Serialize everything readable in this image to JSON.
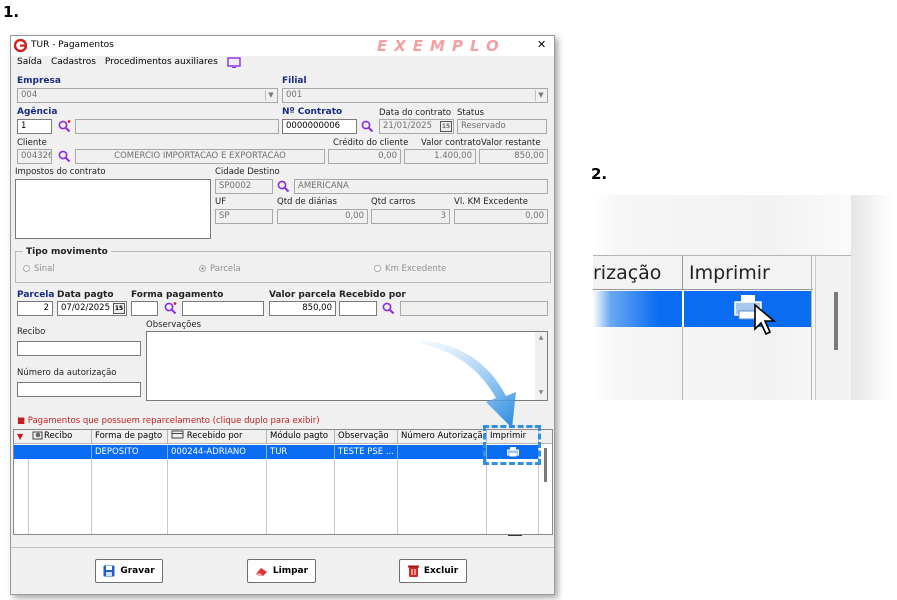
{
  "steps": {
    "one": "1.",
    "two": "2."
  },
  "window": {
    "title": "TUR - Pagamentos",
    "watermark": "EXEMPLO",
    "close": "✕",
    "menu": [
      "Saída",
      "Cadastros",
      "Procedimentos auxiliares"
    ]
  },
  "form": {
    "empresa_label": "Empresa",
    "empresa_value": "004",
    "filial_label": "Filial",
    "filial_value": "001",
    "agencia_label": "Agência",
    "agencia_value": "1",
    "contrato_label": "Nº Contrato",
    "contrato_value": "0000000006",
    "data_contrato_label": "Data do contrato",
    "data_contrato_value": "21/01/2025",
    "status_label": "Status",
    "status_value": "Reservado",
    "cliente_label": "Cliente",
    "cliente_code": "004326",
    "cliente_name": "COMERCIO IMPORTACAO E EXPORTACAO",
    "credito_label": "Crédito do cliente",
    "credito_value": "0,00",
    "valor_contrato_label": "Valor contrato",
    "valor_contrato_value": "1.400,00",
    "valor_restante_label": "Valor restante",
    "valor_restante_value": "850,00",
    "impostos_label": "Impostos do contrato",
    "cidade_label": "Cidade Destino",
    "cidade_code": "SP0002",
    "cidade_name": "AMERICANA",
    "uf_label": "UF",
    "uf_value": "SP",
    "diarias_label": "Qtd de diárias",
    "diarias_value": "0,00",
    "carros_label": "Qtd carros",
    "carros_value": "3",
    "km_label": "Vl. KM Excedente",
    "km_value": "0,00",
    "tipo_label": "Tipo movimento",
    "tipo_options": [
      "Sinal",
      "Parcela",
      "Km Excedente"
    ],
    "parcela_label": "Parcela",
    "parcela_value": "2",
    "data_pagto_label": "Data pagto",
    "data_pagto_value": "07/02/2025",
    "forma_label": "Forma pagamento",
    "valor_parcela_label": "Valor parcela",
    "valor_parcela_value": "850,00",
    "recebido_label": "Recebido por",
    "recibo_label": "Recibo",
    "observacoes_label": "Observações",
    "autorizacao_label": "Número da autorização"
  },
  "grid": {
    "note": "Pagamentos que possuem reparcelamento (clique duplo para exibir)",
    "headers": [
      "Recibo",
      "Forma de pagto",
      "Recebido por",
      "Módulo pagto",
      "Observação",
      "Número Autorização",
      "Imprimir"
    ],
    "row": [
      "",
      "DEPOSITO",
      "000244-ADRIANO",
      "TUR",
      "TESTE PSE ...",
      ""
    ]
  },
  "buttons": {
    "gravar": "Gravar",
    "limpar": "Limpar",
    "excluir": "Excluir"
  },
  "zoom": {
    "col_left": "rização",
    "col_right": "Imprimir"
  },
  "colors": {
    "accent": "#0066ff",
    "selection": "#0a6cf0",
    "highlight": "#2f8fe6",
    "label_blue": "#1a2a80"
  }
}
